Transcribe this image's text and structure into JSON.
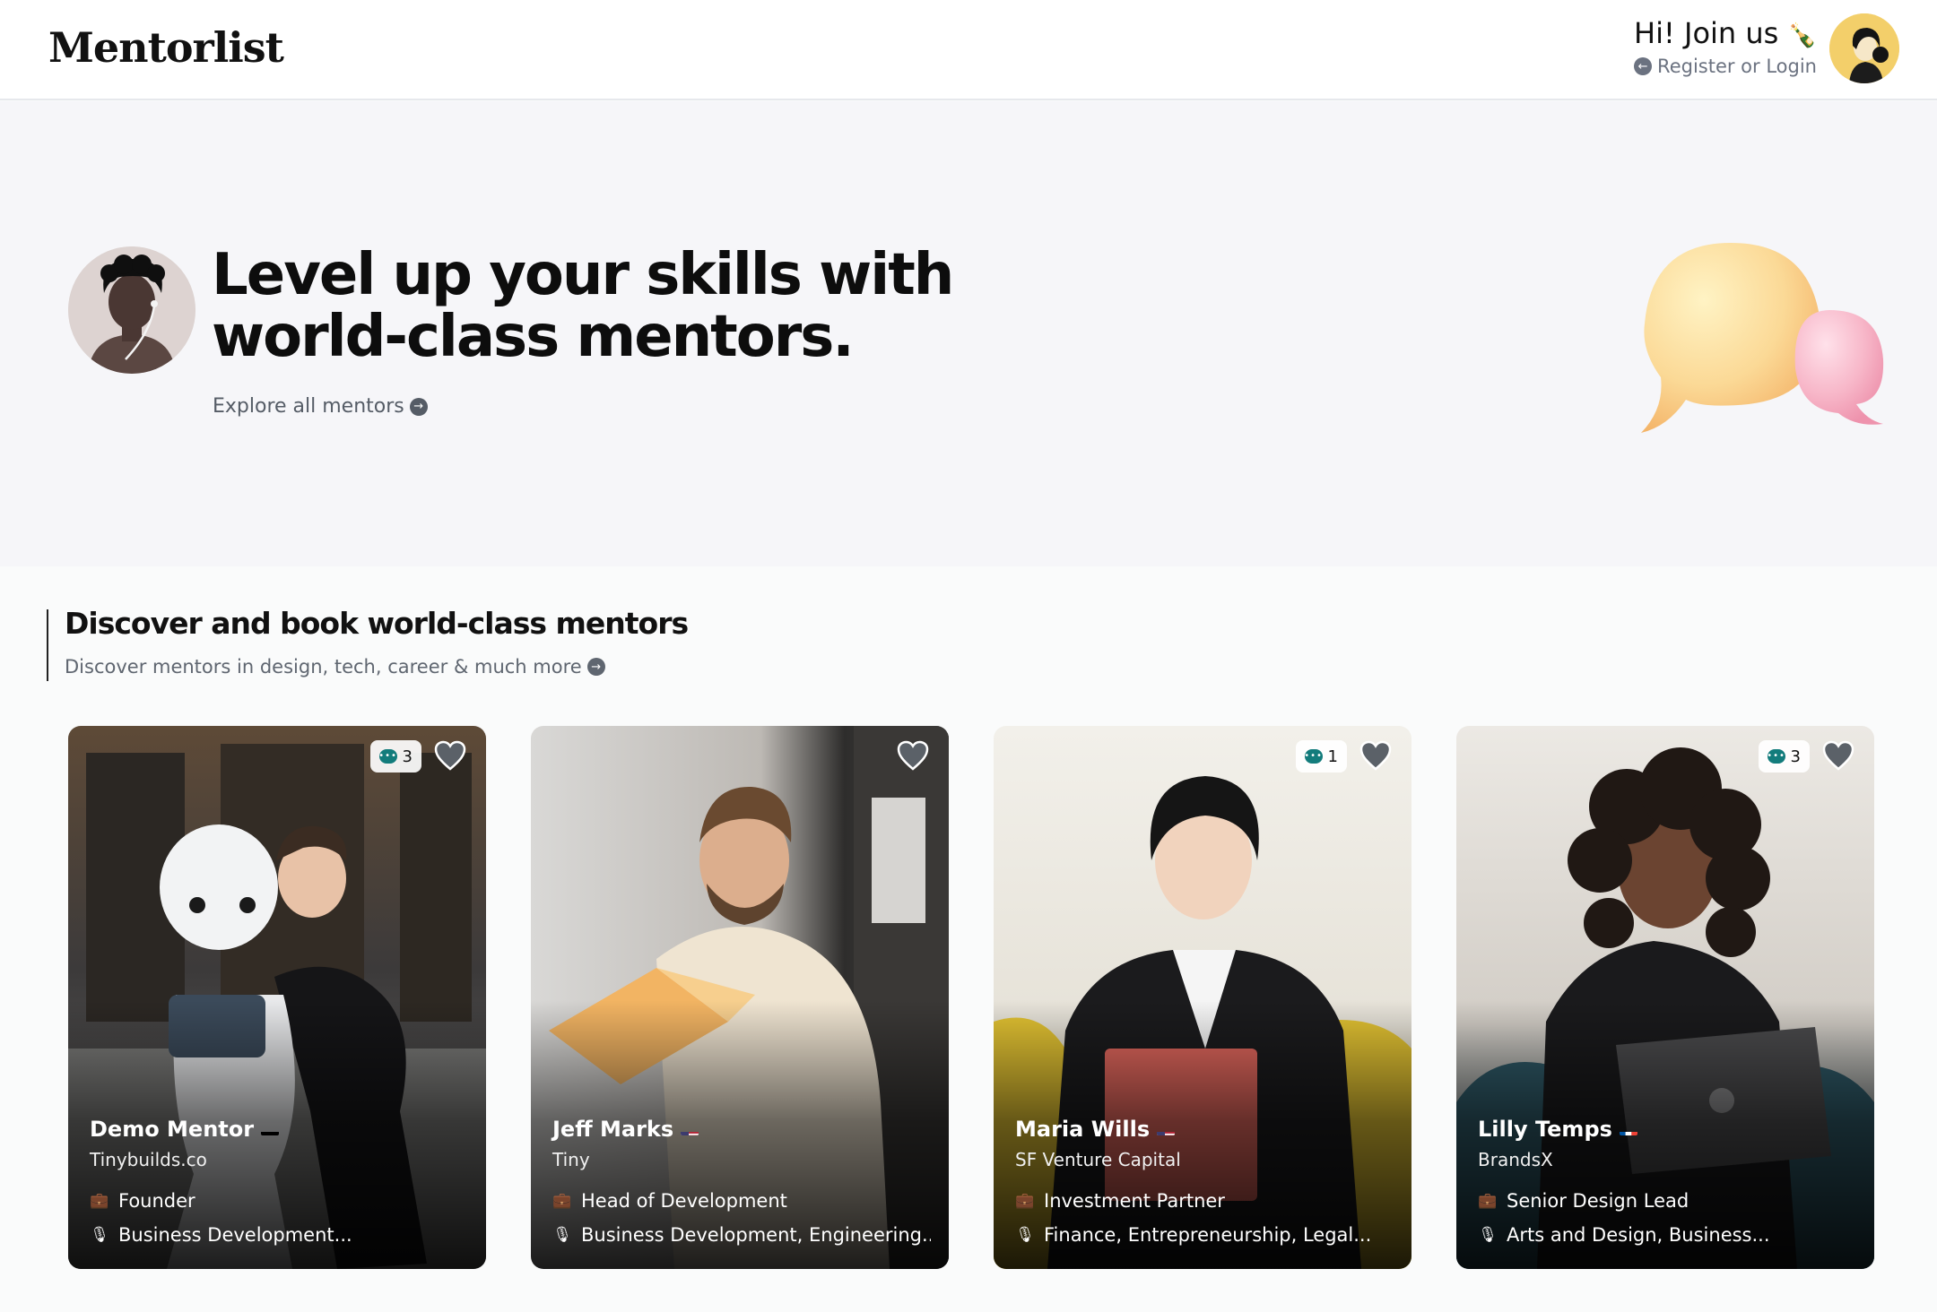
{
  "header": {
    "logo": "Mentorlist",
    "join_title": "Hi! Join us",
    "join_emoji": "🍾",
    "join_sub": "Register or Login"
  },
  "hero": {
    "title": "Level up your skills with world-class mentors.",
    "link": "Explore all mentors"
  },
  "section": {
    "title": "Discover and book world-class mentors",
    "subtitle": "Discover mentors in design, tech, career & much more"
  },
  "mentors": [
    {
      "name": "Demo Mentor",
      "flag": "de",
      "company": "Tinybuilds.co",
      "role": "Founder",
      "topics": "Business Development...",
      "reviews": "3"
    },
    {
      "name": "Jeff Marks",
      "flag": "us",
      "company": "Tiny",
      "role": "Head of Development",
      "topics": "Business Development, Engineering...",
      "reviews": ""
    },
    {
      "name": "Maria Wills",
      "flag": "us",
      "company": "SF Venture Capital",
      "role": "Investment Partner",
      "topics": "Finance, Entrepreneurship, Legal...",
      "reviews": "1"
    },
    {
      "name": "Lilly Temps",
      "flag": "fr",
      "company": "BrandsX",
      "role": "Senior Design Lead",
      "topics": "Arts and Design, Business...",
      "reviews": "3"
    }
  ],
  "icons": {
    "briefcase": "briefcase-icon",
    "mic": "microphone-icon",
    "heart": "heart-icon",
    "chat": "chat-bubble-icon",
    "arrow": "arrow-circle-right-icon"
  },
  "colors": {
    "hero_bg": "#f6f6f9",
    "chat_badge": "#137c7c",
    "avatar_bg": "#f3cf6a"
  }
}
